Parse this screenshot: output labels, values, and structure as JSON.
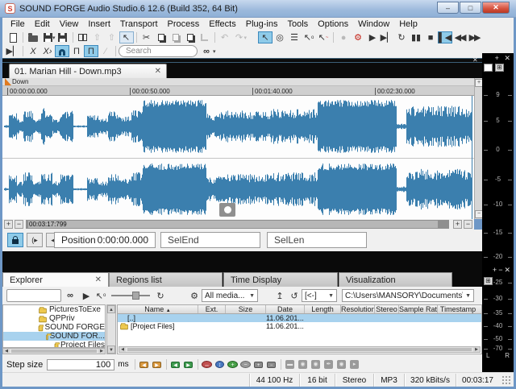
{
  "window": {
    "title": "SOUND FORGE Audio Studio.6 12.6 (Build 352, 64 Bit)",
    "logo_letter": "S"
  },
  "menu": {
    "items": [
      "File",
      "Edit",
      "View",
      "Insert",
      "Transport",
      "Process",
      "Effects",
      "Plug-ins",
      "Tools",
      "Options",
      "Window",
      "Help"
    ]
  },
  "toolbars": {
    "search_placeholder": "Search"
  },
  "doc": {
    "tab": "01. Marian Hill - Down.mp3",
    "marker": "Down",
    "ruler": [
      "00:00:00.000",
      "00:00:50.000",
      "00:01:40.000",
      "00:02:30.000"
    ],
    "scroll_time": "00:03:17:799"
  },
  "selbar": {
    "position_label": "Position",
    "position_value": "0:00:00.000",
    "selend_label": "SelEnd",
    "sellen_label": "SelLen"
  },
  "meter": {
    "ticks": [
      "9",
      "5",
      "0",
      "-5",
      "-10",
      "-15",
      "-20",
      "-25",
      "-30",
      "-35",
      "-40",
      "-50",
      "-70"
    ],
    "left": "L",
    "right": "R"
  },
  "panel": {
    "tabs": [
      "Explorer",
      "Regions list",
      "Time Display",
      "Visualization"
    ],
    "media_filter": "All media...",
    "history": "[<-]",
    "path": "C:\\Users\\MANSORY\\Documents\\SOUND F",
    "tree": [
      "PicturesToExe",
      "QPPriv",
      "SOUND FORGE",
      "SOUND FOR...",
      "Project Files"
    ],
    "columns": [
      "Name",
      "Ext.",
      "Size",
      "Date",
      "Length",
      "Resolution",
      "Stereo",
      "Sample Rate",
      "Timestamp"
    ],
    "rows": [
      {
        "name": "[..]",
        "date": "11.06.201..."
      },
      {
        "name": "[Project Files]",
        "date": "11.06.201..."
      }
    ],
    "step_label": "Step size",
    "step_value": "100",
    "step_unit": "ms"
  },
  "status": {
    "items": [
      "44 100 Hz",
      "16 bit",
      "Stereo",
      "MP3",
      "320 kBits/s",
      "00:03:17"
    ]
  },
  "waveform": {
    "color": "#3b7fae",
    "seed": 1337,
    "sections": [
      [
        0,
        6,
        0.05
      ],
      [
        6,
        16,
        0.52
      ],
      [
        16,
        24,
        0.28
      ],
      [
        24,
        36,
        0.62
      ],
      [
        36,
        46,
        0.34
      ],
      [
        46,
        60,
        0.66
      ],
      [
        60,
        70,
        0.3
      ],
      [
        70,
        86,
        0.56
      ],
      [
        86,
        103,
        0.04
      ],
      [
        103,
        117,
        0.46
      ],
      [
        117,
        129,
        0.3
      ],
      [
        129,
        143,
        0.56
      ],
      [
        143,
        158,
        0.38
      ],
      [
        158,
        172,
        0.62
      ],
      [
        172,
        251,
        0.94
      ],
      [
        251,
        263,
        0.45
      ],
      [
        263,
        332,
        0.56
      ],
      [
        332,
        389,
        0.63
      ],
      [
        389,
        487,
        0.94
      ],
      [
        487,
        499,
        0.1
      ],
      [
        499,
        580,
        0.74
      ]
    ]
  }
}
